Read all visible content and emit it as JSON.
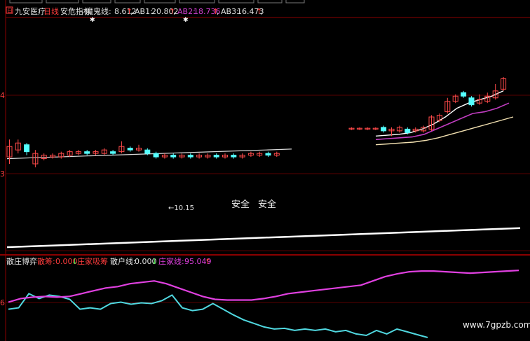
{
  "header": {
    "badge": "日",
    "stock_name": "九安医疗",
    "period": "日线",
    "indicator_name": "安危指标",
    "mogui_label": "魔鬼线:",
    "mogui_value": "8.612",
    "ab1_label": "AB1:",
    "ab1_value": "20.802",
    "ab2_label": "AB2:",
    "ab2_value": "18.736",
    "ab3_label": "AB3:",
    "ab3_value": "16.473",
    "arrow_up": "↑",
    "comma": ","
  },
  "upper_panel": {
    "axis_labels": [
      "4",
      "3"
    ],
    "annotation_low": "←10.15",
    "safe_labels": [
      "安全",
      "安全"
    ]
  },
  "lower_panel": {
    "indicator_name": "散庄博弈",
    "sanchou_label": "散筹:",
    "sanchou_value": "0.000",
    "arrow_down": "↓",
    "zhuang_label": "庄家吸筹",
    "sanhu_label": "散户线:",
    "sanhu_value": "0.000",
    "zhuangjia_label": "庄家线:",
    "zhuangjia_value": "95.049",
    "axis_labels": [
      "6"
    ],
    "watermark": "www.7gpzb.com"
  },
  "colors": {
    "up_candle": "#ff4a4a",
    "down_candle": "#54ffff",
    "ma_magenta": "#c23dc2",
    "ma_white": "#ffffff",
    "ma_cream": "#f2e0b0",
    "grid_red": "#8b0000",
    "zhuang_line": "#e040e0",
    "sanhu_line": "#50d8e0"
  },
  "chart_data": [
    {
      "type": "candlestick",
      "candles_left": [
        {
          "o": 0.54,
          "c": 0.6,
          "h": 0.64,
          "l": 0.5
        },
        {
          "o": 0.58,
          "c": 0.62,
          "h": 0.64,
          "l": 0.56
        },
        {
          "o": 0.61,
          "c": 0.57,
          "h": 0.62,
          "l": 0.55
        },
        {
          "o": 0.5,
          "c": 0.56,
          "h": 0.58,
          "l": 0.48
        },
        {
          "o": 0.53,
          "c": 0.55,
          "h": 0.56,
          "l": 0.52
        },
        {
          "o": 0.54,
          "c": 0.55,
          "h": 0.56,
          "l": 0.53
        },
        {
          "o": 0.54,
          "c": 0.56,
          "h": 0.57,
          "l": 0.53
        },
        {
          "o": 0.55,
          "c": 0.57,
          "h": 0.58,
          "l": 0.54
        },
        {
          "o": 0.56,
          "c": 0.57,
          "h": 0.58,
          "l": 0.55
        },
        {
          "o": 0.57,
          "c": 0.56,
          "h": 0.58,
          "l": 0.55
        },
        {
          "o": 0.56,
          "c": 0.57,
          "h": 0.58,
          "l": 0.55
        },
        {
          "o": 0.56,
          "c": 0.58,
          "h": 0.59,
          "l": 0.55
        },
        {
          "o": 0.57,
          "c": 0.56,
          "h": 0.58,
          "l": 0.55
        },
        {
          "o": 0.57,
          "c": 0.6,
          "h": 0.63,
          "l": 0.56
        },
        {
          "o": 0.59,
          "c": 0.58,
          "h": 0.6,
          "l": 0.57
        },
        {
          "o": 0.58,
          "c": 0.59,
          "h": 0.61,
          "l": 0.57
        },
        {
          "o": 0.58,
          "c": 0.56,
          "h": 0.59,
          "l": 0.55
        },
        {
          "o": 0.56,
          "c": 0.54,
          "h": 0.57,
          "l": 0.53
        },
        {
          "o": 0.54,
          "c": 0.55,
          "h": 0.56,
          "l": 0.53
        },
        {
          "o": 0.55,
          "c": 0.54,
          "h": 0.56,
          "l": 0.53
        },
        {
          "o": 0.54,
          "c": 0.55,
          "h": 0.56,
          "l": 0.53
        },
        {
          "o": 0.55,
          "c": 0.54,
          "h": 0.56,
          "l": 0.53
        },
        {
          "o": 0.54,
          "c": 0.55,
          "h": 0.56,
          "l": 0.53
        },
        {
          "o": 0.54,
          "c": 0.55,
          "h": 0.56,
          "l": 0.53
        },
        {
          "o": 0.55,
          "c": 0.54,
          "h": 0.56,
          "l": 0.53
        },
        {
          "o": 0.54,
          "c": 0.55,
          "h": 0.56,
          "l": 0.53
        },
        {
          "o": 0.55,
          "c": 0.54,
          "h": 0.56,
          "l": 0.53
        },
        {
          "o": 0.54,
          "c": 0.55,
          "h": 0.56,
          "l": 0.53
        },
        {
          "o": 0.55,
          "c": 0.56,
          "h": 0.57,
          "l": 0.54
        },
        {
          "o": 0.55,
          "c": 0.56,
          "h": 0.57,
          "l": 0.54
        },
        {
          "o": 0.56,
          "c": 0.55,
          "h": 0.57,
          "l": 0.54
        },
        {
          "o": 0.55,
          "c": 0.56,
          "h": 0.57,
          "l": 0.54
        }
      ],
      "candles_right": [
        {
          "o": 0.7,
          "c": 0.705,
          "h": 0.71,
          "l": 0.695
        },
        {
          "o": 0.7,
          "c": 0.705,
          "h": 0.71,
          "l": 0.695
        },
        {
          "o": 0.7,
          "c": 0.705,
          "h": 0.71,
          "l": 0.695
        },
        {
          "o": 0.7,
          "c": 0.705,
          "h": 0.71,
          "l": 0.695
        },
        {
          "o": 0.71,
          "c": 0.69,
          "h": 0.72,
          "l": 0.68
        },
        {
          "o": 0.69,
          "c": 0.7,
          "h": 0.71,
          "l": 0.66
        },
        {
          "o": 0.69,
          "c": 0.71,
          "h": 0.72,
          "l": 0.68
        },
        {
          "o": 0.7,
          "c": 0.68,
          "h": 0.71,
          "l": 0.67
        },
        {
          "o": 0.69,
          "c": 0.7,
          "h": 0.71,
          "l": 0.68
        },
        {
          "o": 0.69,
          "c": 0.71,
          "h": 0.72,
          "l": 0.68
        },
        {
          "o": 0.7,
          "c": 0.77,
          "h": 0.78,
          "l": 0.69
        },
        {
          "o": 0.75,
          "c": 0.78,
          "h": 0.79,
          "l": 0.74
        },
        {
          "o": 0.8,
          "c": 0.86,
          "h": 0.88,
          "l": 0.79
        },
        {
          "o": 0.86,
          "c": 0.89,
          "h": 0.9,
          "l": 0.85
        },
        {
          "o": 0.91,
          "c": 0.89,
          "h": 0.92,
          "l": 0.88
        },
        {
          "o": 0.88,
          "c": 0.84,
          "h": 0.89,
          "l": 0.83
        },
        {
          "o": 0.85,
          "c": 0.87,
          "h": 0.9,
          "l": 0.84
        },
        {
          "o": 0.86,
          "c": 0.89,
          "h": 0.91,
          "l": 0.85
        },
        {
          "o": 0.88,
          "c": 0.92,
          "h": 0.96,
          "l": 0.87
        },
        {
          "o": 0.93,
          "c": 0.99,
          "h": 1.0,
          "l": 0.92
        }
      ],
      "ma_white_left": [
        0.53,
        0.535,
        0.54,
        0.545,
        0.55,
        0.555,
        0.56,
        0.565,
        0.57,
        0.575,
        0.58,
        0.585
      ],
      "ma_white_right": [
        0.66,
        0.665,
        0.67,
        0.68,
        0.7,
        0.73,
        0.77,
        0.82,
        0.85,
        0.87,
        0.89,
        0.92
      ],
      "ma_magenta_right": [
        0.64,
        0.645,
        0.65,
        0.655,
        0.67,
        0.7,
        0.73,
        0.76,
        0.79,
        0.8,
        0.82,
        0.85
      ],
      "ma_cream_right": [
        0.61,
        0.615,
        0.62,
        0.625,
        0.635,
        0.65,
        0.67,
        0.69,
        0.71,
        0.73,
        0.75,
        0.77
      ],
      "long_trend": [
        0.02,
        0.03,
        0.04,
        0.05,
        0.06,
        0.07,
        0.08,
        0.09,
        0.1,
        0.11,
        0.12,
        0.13
      ]
    },
    {
      "type": "line",
      "series": [
        {
          "name": "庄家线",
          "values": [
            50,
            55,
            57,
            58,
            57,
            58,
            62,
            66,
            70,
            72,
            76,
            78,
            80,
            76,
            70,
            64,
            58,
            54,
            53,
            53,
            53,
            55,
            58,
            62,
            64,
            66,
            68,
            70,
            72,
            74,
            80,
            86,
            90,
            93,
            94,
            94,
            93,
            92,
            91,
            92,
            93,
            94,
            95
          ]
        },
        {
          "name": "散户线",
          "values": [
            40,
            42,
            62,
            55,
            60,
            58,
            54,
            40,
            42,
            40,
            48,
            50,
            47,
            49,
            48,
            52,
            60,
            42,
            38,
            40,
            48,
            40,
            32,
            25,
            20,
            15,
            12,
            13,
            10,
            12,
            10,
            12,
            8,
            10,
            5,
            3,
            10,
            5,
            12,
            8,
            4,
            0
          ]
        }
      ],
      "ylim": [
        0,
        100
      ]
    }
  ]
}
